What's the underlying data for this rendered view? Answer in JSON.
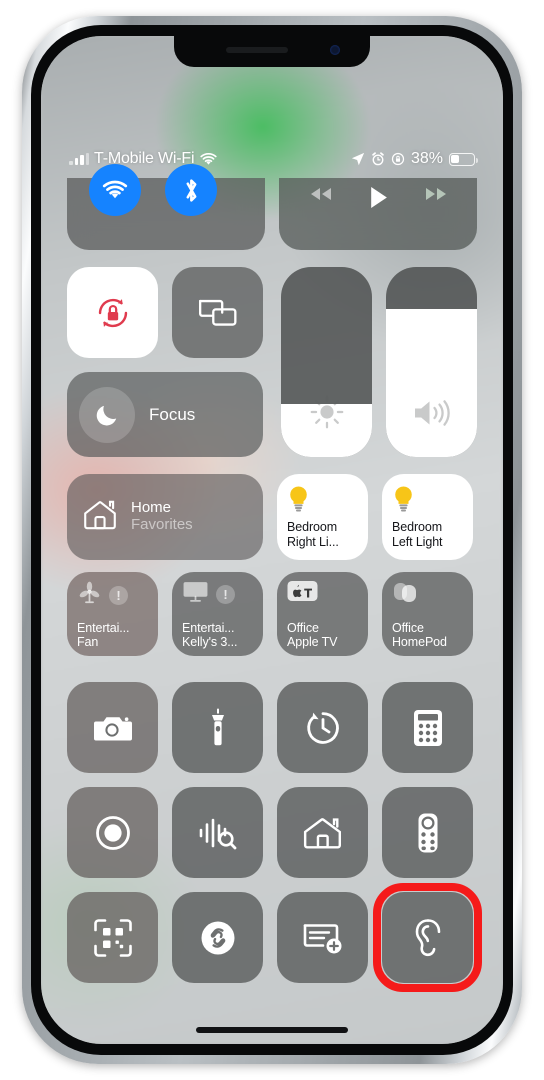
{
  "device": {
    "name": "iphone-frame",
    "notch": {
      "speaker": "earpiece-speaker",
      "camera": "front-camera"
    }
  },
  "status_bar": {
    "signal_icon": "cellular-signal-icon",
    "carrier": "T-Mobile Wi-Fi",
    "wifi_icon": "wifi-icon",
    "location_icon": "location-arrow-icon",
    "alarm_icon": "alarm-clock-icon",
    "rotation_lock_icon": "rotation-lock-icon",
    "battery_percent": "38%",
    "battery_level": 38,
    "battery_icon": "battery-icon"
  },
  "control_center": {
    "connectivity": {
      "wifi": {
        "label": "Wi-Fi",
        "icon": "wifi-icon",
        "state": "on",
        "color": "#1583ff"
      },
      "bluetooth": {
        "label": "Bluetooth",
        "icon": "bluetooth-icon",
        "state": "on",
        "color": "#1583ff"
      }
    },
    "media": {
      "rewind": {
        "label": "Rewind",
        "icon": "rewind-icon"
      },
      "play": {
        "label": "Play",
        "icon": "play-icon"
      },
      "forward": {
        "label": "Fast Forward",
        "icon": "fast-forward-icon"
      }
    },
    "rotation_lock": {
      "label": "Portrait Orientation Lock",
      "icon": "rotation-lock-icon",
      "state": "on",
      "color": "#e03b4e"
    },
    "screen_mirroring": {
      "label": "Screen Mirroring",
      "icon": "screen-mirroring-icon",
      "state": "off"
    },
    "focus": {
      "label": "Focus",
      "icon": "moon-icon",
      "state": "off"
    },
    "brightness": {
      "label": "Brightness",
      "icon": "brightness-icon",
      "value": 28
    },
    "volume": {
      "label": "Volume",
      "icon": "volume-icon",
      "value": 78
    },
    "home": {
      "title": "Home",
      "subtitle": "Favorites",
      "icon": "home-icon"
    },
    "lights": [
      {
        "name": "Bedroom\nRight Li...",
        "icon": "lightbulb-icon",
        "state": "on",
        "color": "#f7c518"
      },
      {
        "name": "Bedroom\nLeft Light",
        "icon": "lightbulb-icon",
        "state": "on",
        "color": "#f7c518"
      }
    ],
    "accessories": [
      {
        "name": "Entertai...\nFan",
        "icon": "fan-icon",
        "badge": "!",
        "style": "warm"
      },
      {
        "name": "Entertai...\nKelly's 3...",
        "icon": "tv-icon",
        "badge": "!",
        "style": "normal"
      },
      {
        "name": "Office\nApple TV",
        "icon": "apple-tv-icon",
        "badge": "",
        "style": "normal"
      },
      {
        "name": "Office\nHomePod",
        "icon": "homepod-icon",
        "badge": "",
        "style": "normal"
      }
    ],
    "utility_rows": [
      [
        {
          "label": "Camera",
          "icon": "camera-icon",
          "style": "dim"
        },
        {
          "label": "Flashlight",
          "icon": "flashlight-icon",
          "style": "normal"
        },
        {
          "label": "Timer",
          "icon": "timer-icon",
          "style": "normal"
        },
        {
          "label": "Calculator",
          "icon": "calculator-icon",
          "style": "normal"
        }
      ],
      [
        {
          "label": "Screen Recording",
          "icon": "screen-record-icon",
          "style": "dim"
        },
        {
          "label": "Sound Recognition",
          "icon": "sound-recognition-icon",
          "style": "normal"
        },
        {
          "label": "Home",
          "icon": "home-outline-icon",
          "style": "normal"
        },
        {
          "label": "Apple TV Remote",
          "icon": "remote-icon",
          "style": "normal"
        }
      ],
      [
        {
          "label": "Code Scanner",
          "icon": "qr-scanner-icon",
          "style": "dim"
        },
        {
          "label": "Shazam",
          "icon": "shazam-icon",
          "style": "normal"
        },
        {
          "label": "Quick Note",
          "icon": "quick-note-icon",
          "style": "normal"
        },
        {
          "label": "Hearing",
          "icon": "ear-icon",
          "style": "normal",
          "highlighted": true
        }
      ]
    ],
    "highlight": {
      "name": "hearing-highlight",
      "color": "#f51a1a"
    },
    "home_indicator": "home-indicator"
  }
}
